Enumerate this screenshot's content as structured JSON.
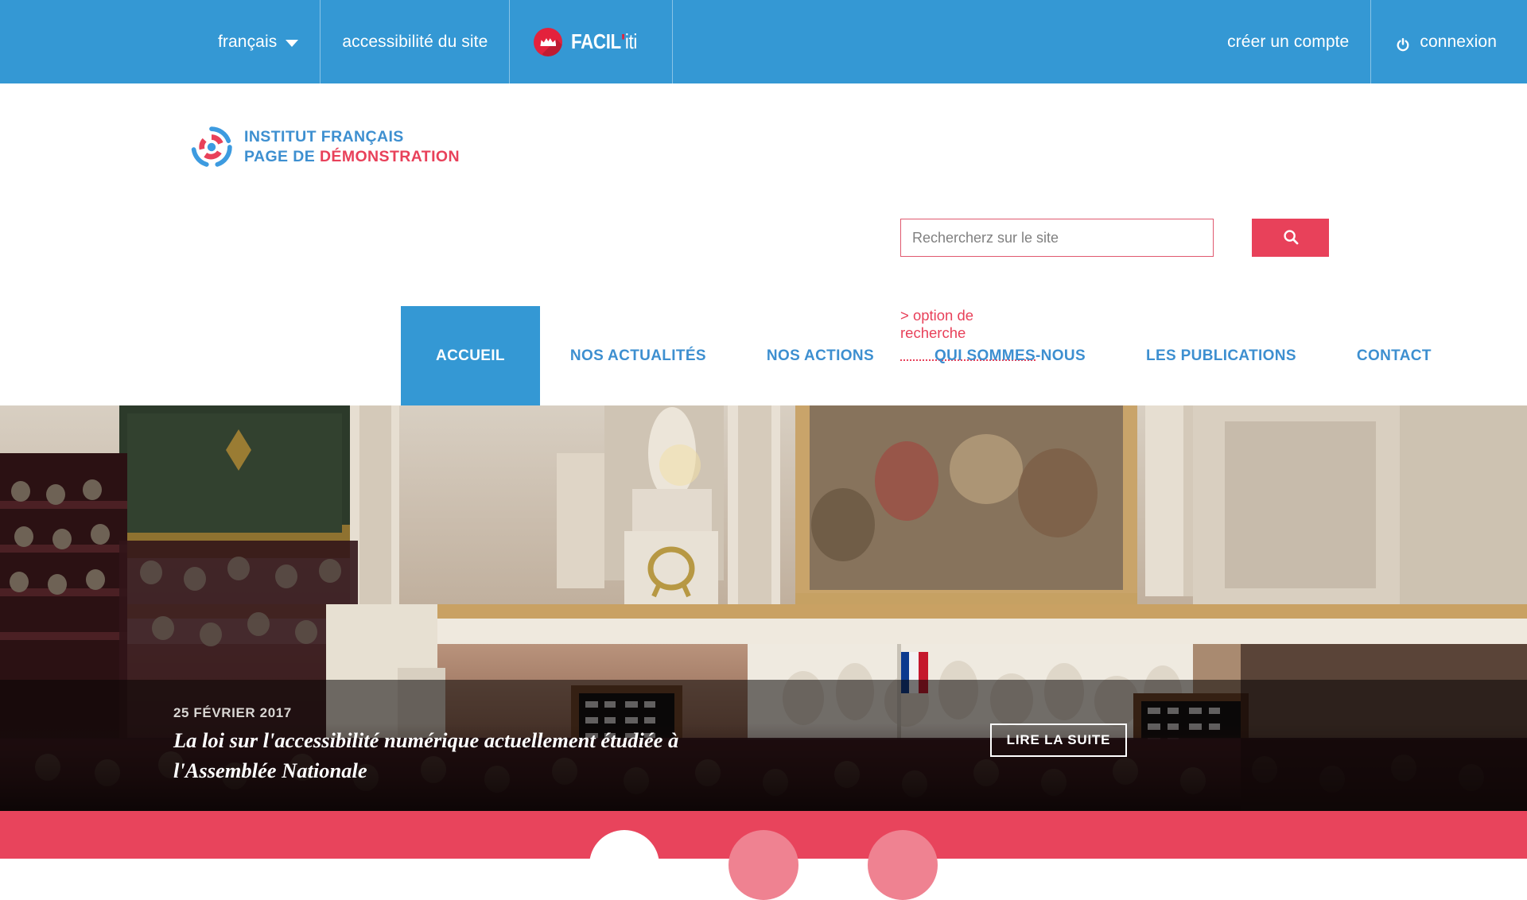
{
  "topbar": {
    "language": {
      "label": "français",
      "icon": "chevron-down-icon"
    },
    "accessibility_label": "accessibilité du site",
    "faciliti": {
      "name_main": "FACIL",
      "apostrophe": "'",
      "name_suffix": "iti",
      "icon": "crown-icon"
    },
    "create_account_label": "créer un compte",
    "login": {
      "label": "connexion",
      "icon": "power-icon"
    },
    "bg_color": "#3498d4"
  },
  "header": {
    "brand": {
      "icon": "circular-swirl-logo-icon",
      "line1": "INSTITUT FRANÇAIS",
      "line2_prefix": "PAGE DE ",
      "line2_accent": "DÉMONSTRATION",
      "blue": "#3d8fd0",
      "red": "#e8415a"
    },
    "search": {
      "placeholder": "Rechercherz sur le site",
      "value": "",
      "button_icon": "search-icon",
      "button_color": "#e8415a",
      "options_link": "> option de recherche"
    }
  },
  "nav": {
    "items": [
      {
        "label": "ACCUEIL",
        "active": true
      },
      {
        "label": "NOS ACTUALITÉS",
        "active": false
      },
      {
        "label": "NOS ACTIONS",
        "active": false
      },
      {
        "label": "QUI SOMMES-NOUS",
        "active": false
      },
      {
        "label": "LES PUBLICATIONS",
        "active": false
      },
      {
        "label": "CONTACT",
        "active": false
      }
    ],
    "active_bg": "#3498d4",
    "link_color": "#3d8fd0"
  },
  "hero": {
    "image_alt": "Hémicycle de l'Assemblée Nationale",
    "date": "25 FÉVRIER 2017",
    "title": "La loi sur l'accessibilité numérique actuellement étudiée à l'Assemblée Nationale",
    "cta_label": "LIRE LA SUITE"
  },
  "carousel": {
    "strip_color": "#e8445c",
    "dots": [
      {
        "name": "slide-1",
        "active": true
      },
      {
        "name": "slide-2",
        "active": false
      },
      {
        "name": "slide-3",
        "active": false
      }
    ],
    "active_color": "#ffffff",
    "inactive_color": "#ef8291"
  }
}
